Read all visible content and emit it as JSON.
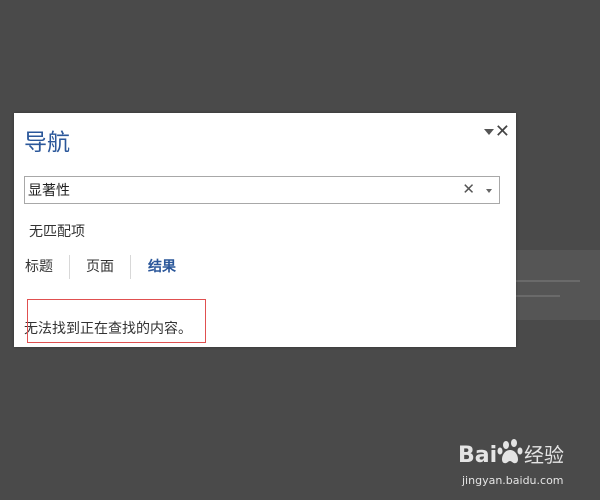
{
  "navigation_pane": {
    "title": "导航",
    "menu_icon": "chevron-down-icon",
    "close_icon": "close-icon",
    "close_symbol": "✕",
    "search": {
      "value": "显著性",
      "clear_icon": "close-icon",
      "clear_symbol": "✕",
      "dropdown_icon": "chevron-down-icon"
    },
    "match_status": "无匹配项",
    "tabs": [
      {
        "label": "标题",
        "active": false
      },
      {
        "label": "页面",
        "active": false
      },
      {
        "label": "结果",
        "active": true
      }
    ],
    "result_message": "无法找到正在查找的内容。"
  },
  "colors": {
    "background": "#4a4a4a",
    "accent": "#2b579a",
    "highlight_border": "#e05050"
  },
  "watermark": {
    "brand": "Baidu经验",
    "url": "jingyan.baidu.com"
  }
}
